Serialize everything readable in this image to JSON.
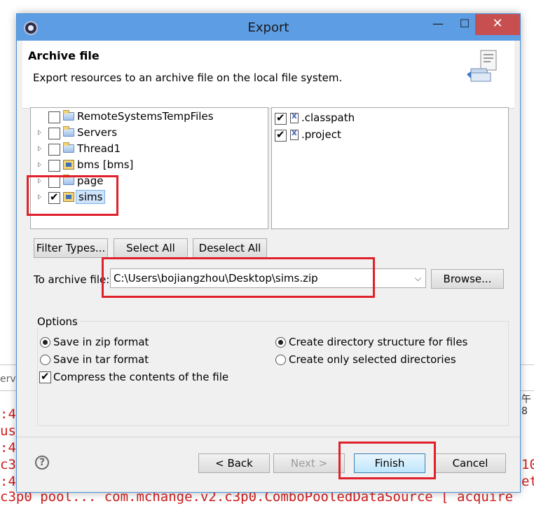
{
  "background": {
    "tab_left": "erve",
    "tab_right": "午8",
    "console_lines": [
      ":4",
      "us",
      ":4",
      "c3",
      ":4"
    ],
    "console_right": [
      "10",
      "et"
    ],
    "console_bottom": "c3p0 pool... com.mchange.v2.c3p0.ComboPooledDataSource [ acquire"
  },
  "window": {
    "title": "Export",
    "minimize": "—",
    "maximize": "☐",
    "close": "✕"
  },
  "header": {
    "title": "Archive file",
    "description": "Export resources to an archive file on the local file system."
  },
  "tree": {
    "items": [
      {
        "label": "RemoteSystemsTempFiles",
        "checked": false,
        "expandable": false
      },
      {
        "label": "Servers",
        "checked": false,
        "expandable": true
      },
      {
        "label": "Thread1",
        "checked": false,
        "expandable": true
      },
      {
        "label": "bms [bms]",
        "checked": false,
        "expandable": true
      },
      {
        "label": "page",
        "checked": false,
        "expandable": true
      },
      {
        "label": "sims",
        "checked": true,
        "expandable": true,
        "selected": true
      }
    ]
  },
  "files": {
    "items": [
      {
        "label": ".classpath",
        "checked": true
      },
      {
        "label": ".project",
        "checked": true
      }
    ]
  },
  "buttons": {
    "filter_types": "Filter Types...",
    "select_all": "Select All",
    "deselect_all": "Deselect All",
    "browse": "Browse...",
    "back": "< Back",
    "next": "Next >",
    "finish": "Finish",
    "cancel": "Cancel",
    "help": "?"
  },
  "archive": {
    "label": "To archive file:",
    "value": "C:\\Users\\bojiangzhou\\Desktop\\sims.zip"
  },
  "options": {
    "title": "Options",
    "zip": "Save in zip format",
    "tar": "Save in tar format",
    "compress": "Compress the contents of the file",
    "create_structure": "Create directory structure for files",
    "create_selected": "Create only selected directories",
    "format_selected": "zip",
    "structure_selected": "create_structure",
    "compress_checked": true
  },
  "colors": {
    "highlight": "#e0202a",
    "titlebar": "#5d9de3",
    "console_text": "#d01c1c"
  }
}
